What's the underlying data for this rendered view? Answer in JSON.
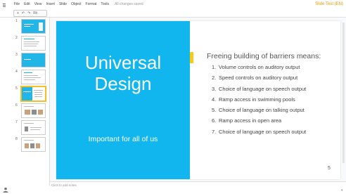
{
  "menubar": {
    "items": [
      "File",
      "Edit",
      "View",
      "Insert",
      "Slide",
      "Object",
      "Format",
      "Tools"
    ],
    "saved_status": "All changes saved",
    "title": "Slide Test (EN)"
  },
  "toolbar": {
    "items": [
      "+",
      "↶",
      "↷",
      "Fit"
    ]
  },
  "thumbnails": {
    "numbers": [
      "1",
      "2",
      "3",
      "4",
      "5",
      "6",
      "7",
      "8"
    ],
    "selected_index": 5
  },
  "slide": {
    "title": "Universal Design",
    "subtitle": "Important for all of us",
    "heading": "Freeing building of barriers means:",
    "items": [
      {
        "num": "1.",
        "text": "Volume controls on auditory output"
      },
      {
        "num": "2.",
        "text": "Speed controls on auditory output"
      },
      {
        "num": "3.",
        "text": "Choice of language on speech output"
      },
      {
        "num": "4.",
        "text": "Ramp access in swimming pools"
      },
      {
        "num": "5.",
        "text": "Choice of language on talking output"
      },
      {
        "num": "6.",
        "text": "Ramp access in open area"
      },
      {
        "num": "7.",
        "text": "Choice of language on speech output"
      }
    ],
    "page_number": "5",
    "accent_color": "#12b6ee"
  },
  "notes": {
    "placeholder": "Click to add notes"
  }
}
